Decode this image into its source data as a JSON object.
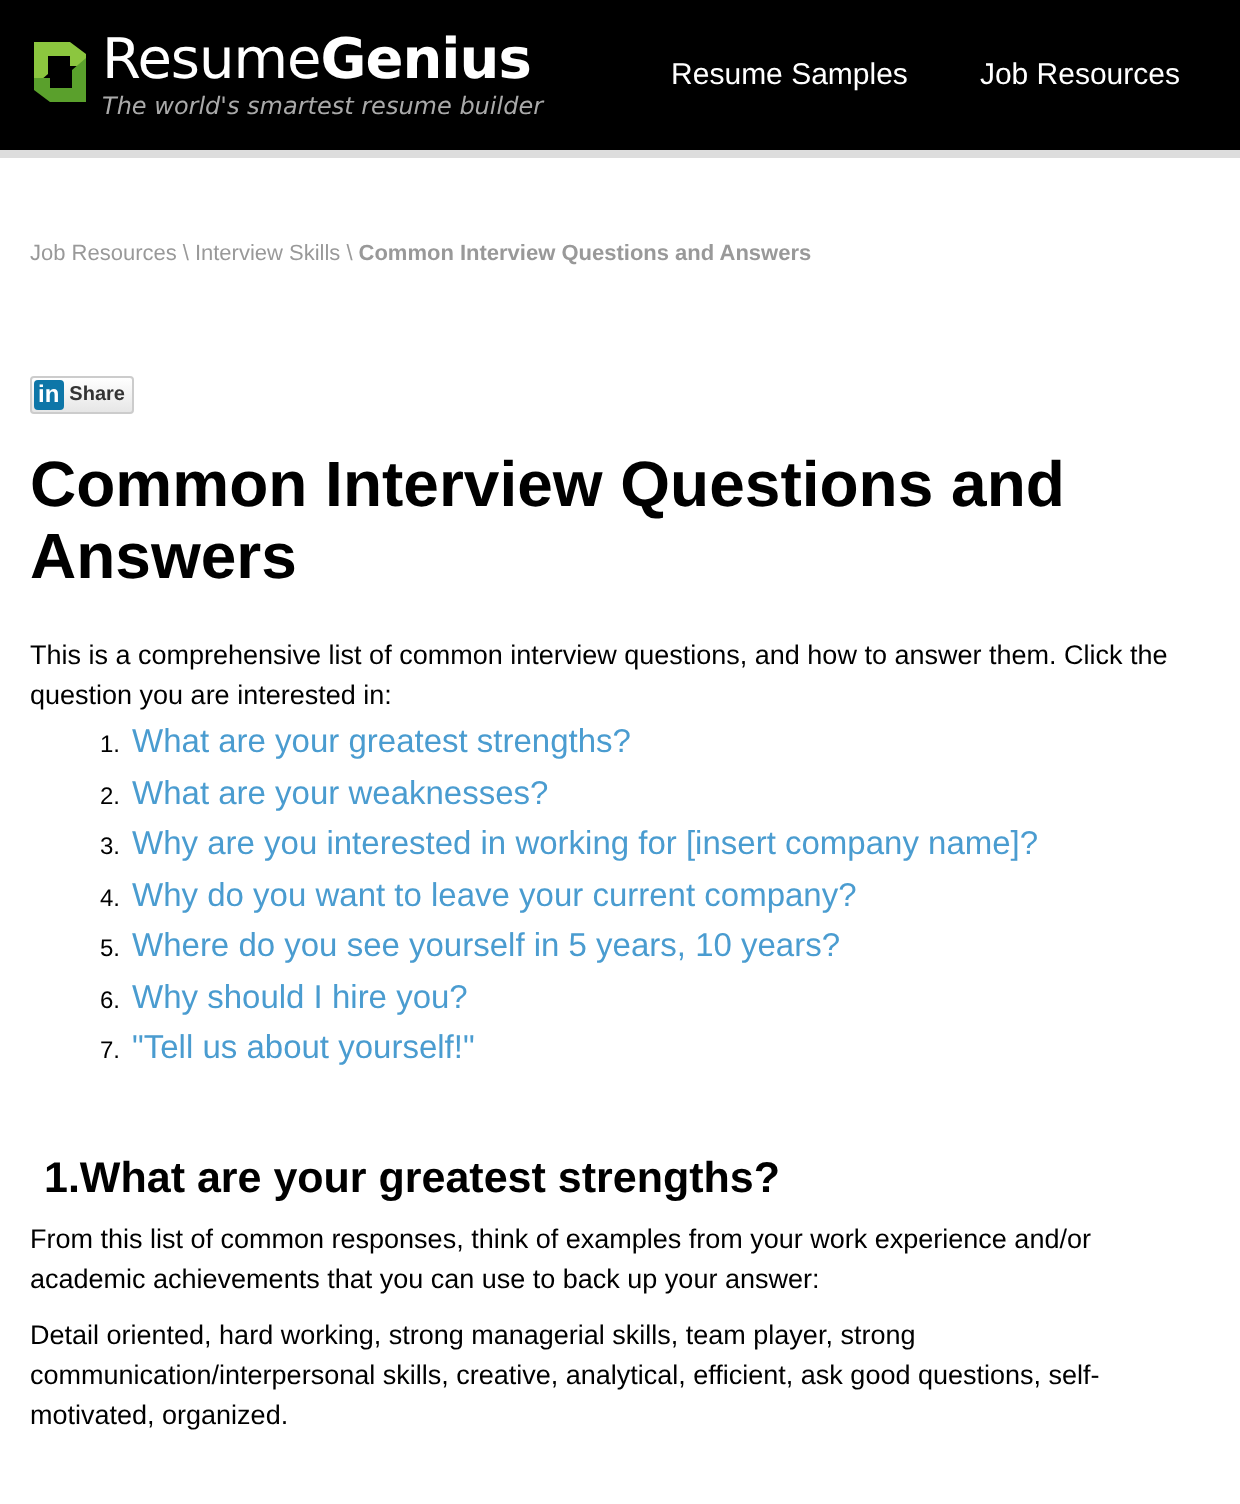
{
  "header": {
    "logo": "Resume**Genius**",
    "tagline": "The world's smartest resume builder",
    "nav": [
      "Resume Samples",
      "Job Resources"
    ]
  },
  "breadcrumb": [
    {
      "label": "Job Resources",
      "current": false
    },
    {
      "label": "Interview Skills",
      "current": false
    },
    {
      "label": "Common Interview Questions and Answers",
      "current": true
    }
  ],
  "breadcrumb_separator": "\\",
  "share": {
    "badge": "in",
    "label": "Share"
  },
  "title": "Common Interview Questions and Answers",
  "intro": "This is a comprehensive list of common interview questions, and how to answer them. Click the question you are interested in:",
  "questions": [
    {
      "number": "1.",
      "text": "What are your greatest strengths?"
    },
    {
      "number": "2.",
      "text": "What are your weaknesses?"
    },
    {
      "number": "3.",
      "text": "Why are you interested in working for [insert company name]?"
    },
    {
      "number": "4.",
      "text": "Why do you want to leave your current company?"
    },
    {
      "number": "5.",
      "text": "Where do you see yourself in 5 years, 10 years?"
    },
    {
      "number": "6.",
      "text": "Why should I hire you?"
    },
    {
      "number": "7.",
      "text": "\"Tell us about yourself!\""
    }
  ],
  "section": {
    "heading": "1.What are your greatest strengths?",
    "paragraphs": [
      "From this list of common responses, think of examples from your work experience and/or academic achievements that you can use to back up your answer:",
      "Detail oriented, hard working, strong managerial skills, team player, strong communication/interpersonal skills, creative, analytical, efficient, ask good questions, self-motivated, organized."
    ]
  }
}
